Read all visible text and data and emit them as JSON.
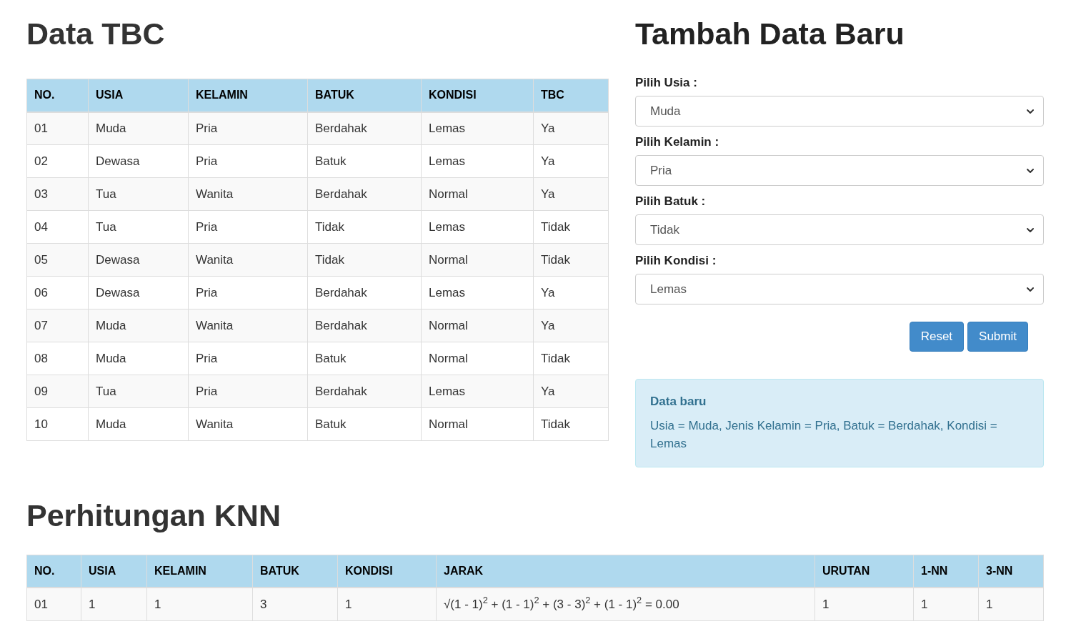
{
  "data_tbc": {
    "title": "Data TBC",
    "columns": [
      "NO.",
      "USIA",
      "KELAMIN",
      "BATUK",
      "KONDISI",
      "TBC"
    ],
    "rows": [
      [
        "01",
        "Muda",
        "Pria",
        "Berdahak",
        "Lemas",
        "Ya"
      ],
      [
        "02",
        "Dewasa",
        "Pria",
        "Batuk",
        "Lemas",
        "Ya"
      ],
      [
        "03",
        "Tua",
        "Wanita",
        "Berdahak",
        "Normal",
        "Ya"
      ],
      [
        "04",
        "Tua",
        "Pria",
        "Tidak",
        "Lemas",
        "Tidak"
      ],
      [
        "05",
        "Dewasa",
        "Wanita",
        "Tidak",
        "Normal",
        "Tidak"
      ],
      [
        "06",
        "Dewasa",
        "Pria",
        "Berdahak",
        "Lemas",
        "Ya"
      ],
      [
        "07",
        "Muda",
        "Wanita",
        "Berdahak",
        "Normal",
        "Ya"
      ],
      [
        "08",
        "Muda",
        "Pria",
        "Batuk",
        "Normal",
        "Tidak"
      ],
      [
        "09",
        "Tua",
        "Pria",
        "Berdahak",
        "Lemas",
        "Ya"
      ],
      [
        "10",
        "Muda",
        "Wanita",
        "Batuk",
        "Normal",
        "Tidak"
      ]
    ]
  },
  "form": {
    "title": "Tambah Data Baru",
    "fields": [
      {
        "label": "Pilih Usia :",
        "value": "Muda"
      },
      {
        "label": "Pilih Kelamin :",
        "value": "Pria"
      },
      {
        "label": "Pilih Batuk :",
        "value": "Tidak"
      },
      {
        "label": "Pilih Kondisi :",
        "value": "Lemas"
      }
    ],
    "buttons": [
      "Reset",
      "Submit"
    ],
    "alert": {
      "title": "Data baru",
      "text": "Usia = Muda, Jenis Kelamin = Pria, Batuk = Berdahak, Kondisi = Lemas"
    }
  },
  "knn": {
    "title": "Perhitungan KNN",
    "columns": [
      "NO.",
      "USIA",
      "KELAMIN",
      "BATUK",
      "KONDISI",
      "JARAK",
      "URUTAN",
      "1-NN",
      "3-NN"
    ],
    "rows": [
      [
        "01",
        "1",
        "1",
        "3",
        "1",
        "√(1 - 1)$^{2}$ + (1 - 1)$^{2}$ + (3 - 3)$^{2}$ + (1 - 1)$^{2}$ = 0.00",
        "1",
        "1",
        "1"
      ]
    ]
  }
}
